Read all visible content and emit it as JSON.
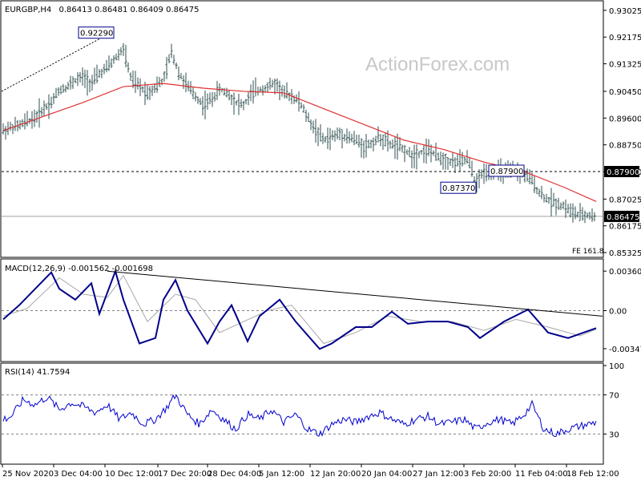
{
  "header": {
    "symbol": "EURGBP,H4",
    "ohlc": "0.86413 0.86481 0.86409 0.86475"
  },
  "watermark": "ActionForex.com",
  "colors": {
    "price": "#2f4f4f",
    "sma": "#e03030",
    "macd": "#00008b",
    "signal": "#a8a8a8",
    "rsi": "#0000cd",
    "current_tag_bg": "#000000",
    "label_box_border": "#00008b",
    "grid_dash": "#808080"
  },
  "chart_data": [
    {
      "type": "candlestick",
      "title": "EURGBP,H4",
      "ylim": [
        0.8525,
        0.932
      ],
      "y_ticks": [
        "0.93025",
        "0.92175",
        "0.91325",
        "0.90450",
        "0.89600",
        "0.88750",
        "0.87900",
        "0.87025",
        "0.86175",
        "0.85325"
      ],
      "x_ticks": [
        "25 Nov 2020",
        "3 Dec 04:00",
        "10 Dec 12:00",
        "17 Dec 20:00",
        "28 Dec 04:00",
        "5 Jan 12:00",
        "12 Jan 20:00",
        "20 Jan 04:00",
        "27 Jan 12:00",
        "3 Feb 20:00",
        "11 Feb 04:00",
        "18 Feb 12:00"
      ],
      "current_price": "0.86475",
      "horizontal_level": "0.87900",
      "annotations": [
        "0.92290",
        "0.87370",
        "0.87900"
      ],
      "fe_label": "FE 161.8",
      "series": [
        {
          "kind": "price",
          "x": [
            0,
            10,
            20,
            30,
            40,
            50,
            60,
            70,
            80,
            90,
            100,
            110,
            120,
            130,
            140,
            150,
            160,
            170,
            180,
            190,
            200,
            210,
            220,
            230,
            240,
            250,
            260,
            270,
            280,
            290,
            300,
            310,
            320,
            330,
            340,
            350,
            360,
            370,
            380,
            390,
            400,
            410,
            420,
            430,
            440,
            450,
            460,
            470,
            480,
            490,
            500,
            510,
            520,
            530,
            540,
            550,
            560,
            570,
            580,
            590,
            600,
            610,
            620,
            630,
            640,
            650,
            660,
            670,
            680,
            690,
            700,
            710,
            720,
            730,
            740
          ],
          "y": [
            0.892,
            0.893,
            0.8935,
            0.895,
            0.896,
            0.899,
            0.901,
            0.905,
            0.906,
            0.908,
            0.909,
            0.907,
            0.91,
            0.912,
            0.915,
            0.918,
            0.908,
            0.906,
            0.904,
            0.906,
            0.908,
            0.917,
            0.91,
            0.906,
            0.903,
            0.9,
            0.902,
            0.905,
            0.904,
            0.901,
            0.9,
            0.904,
            0.905,
            0.906,
            0.907,
            0.904,
            0.903,
            0.901,
            0.896,
            0.892,
            0.889,
            0.89,
            0.891,
            0.89,
            0.889,
            0.887,
            0.888,
            0.89,
            0.888,
            0.887,
            0.886,
            0.884,
            0.885,
            0.886,
            0.884,
            0.883,
            0.882,
            0.882,
            0.883,
            0.875,
            0.879,
            0.878,
            0.879,
            0.8785,
            0.879,
            0.878,
            0.876,
            0.872,
            0.87,
            0.869,
            0.868,
            0.866,
            0.865,
            0.865,
            0.8647
          ]
        },
        {
          "kind": "moving-average",
          "x": [
            0,
            50,
            100,
            150,
            200,
            250,
            300,
            350,
            400,
            450,
            500,
            550,
            600,
            650,
            700,
            740
          ],
          "y": [
            0.892,
            0.8965,
            0.901,
            0.906,
            0.907,
            0.9055,
            0.9045,
            0.904,
            0.899,
            0.894,
            0.889,
            0.886,
            0.882,
            0.879,
            0.874,
            0.8695
          ]
        }
      ]
    },
    {
      "type": "line",
      "title": "MACD(12,26,9) -0.001562 -0.001698",
      "ylim": [
        -0.0045,
        0.0045
      ],
      "y_ticks": [
        "0.003609",
        "0.00",
        "-0.003472"
      ],
      "series": [
        {
          "kind": "macd",
          "x": [
            0,
            20,
            40,
            60,
            70,
            90,
            110,
            120,
            140,
            150,
            170,
            190,
            200,
            215,
            230,
            255,
            270,
            285,
            305,
            320,
            345,
            365,
            395,
            410,
            440,
            460,
            485,
            505,
            530,
            555,
            580,
            595,
            625,
            655,
            680,
            705,
            740
          ],
          "y": [
            -0.0008,
            0.0005,
            0.002,
            0.0035,
            0.002,
            0.001,
            0.0025,
            -0.0003,
            0.0036,
            0.001,
            -0.003,
            -0.0025,
            0.001,
            0.0028,
            0.0,
            -0.003,
            -0.001,
            0.0005,
            -0.0028,
            -0.0005,
            0.001,
            -0.001,
            -0.0035,
            -0.003,
            -0.0015,
            -0.0015,
            -0.0001,
            -0.0012,
            -0.001,
            -0.001,
            -0.0015,
            -0.0025,
            -0.001,
            0.0001,
            -0.002,
            -0.0025,
            -0.0016
          ]
        },
        {
          "kind": "signal",
          "x": [
            0,
            30,
            70,
            100,
            130,
            150,
            180,
            215,
            240,
            270,
            300,
            330,
            360,
            400,
            440,
            480,
            520,
            560,
            600,
            640,
            680,
            720,
            740
          ],
          "y": [
            -0.0005,
            0.0002,
            0.003,
            0.0015,
            0.0012,
            0.0032,
            -0.001,
            0.0015,
            0.001,
            -0.002,
            -0.001,
            0.0,
            0.0005,
            -0.003,
            -0.002,
            -0.0005,
            -0.001,
            -0.001,
            -0.0018,
            -0.0008,
            -0.0015,
            -0.0023,
            -0.0017
          ]
        }
      ],
      "trendline": {
        "x": [
          130,
          800
        ],
        "y": [
          0.0036,
          -0.0005
        ]
      }
    },
    {
      "type": "line",
      "title": "RSI(14) 41.7594",
      "ylim": [
        0,
        100
      ],
      "y_ticks": [
        "100",
        "70",
        "30"
      ],
      "series": [
        {
          "kind": "rsi",
          "x": [
            0,
            10,
            25,
            40,
            55,
            70,
            85,
            100,
            115,
            130,
            145,
            160,
            175,
            190,
            205,
            215,
            230,
            245,
            260,
            275,
            290,
            305,
            320,
            335,
            350,
            365,
            380,
            395,
            410,
            425,
            440,
            455,
            470,
            485,
            500,
            515,
            530,
            545,
            560,
            575,
            590,
            605,
            620,
            635,
            650,
            660,
            675,
            690,
            705,
            720,
            740
          ],
          "y": [
            45,
            48,
            65,
            60,
            68,
            55,
            62,
            58,
            52,
            60,
            45,
            52,
            40,
            45,
            58,
            70,
            50,
            40,
            55,
            45,
            35,
            50,
            45,
            55,
            42,
            50,
            35,
            30,
            40,
            45,
            42,
            48,
            52,
            45,
            40,
            45,
            48,
            40,
            42,
            45,
            35,
            42,
            45,
            40,
            50,
            60,
            35,
            30,
            35,
            38,
            42
          ]
        }
      ]
    }
  ]
}
